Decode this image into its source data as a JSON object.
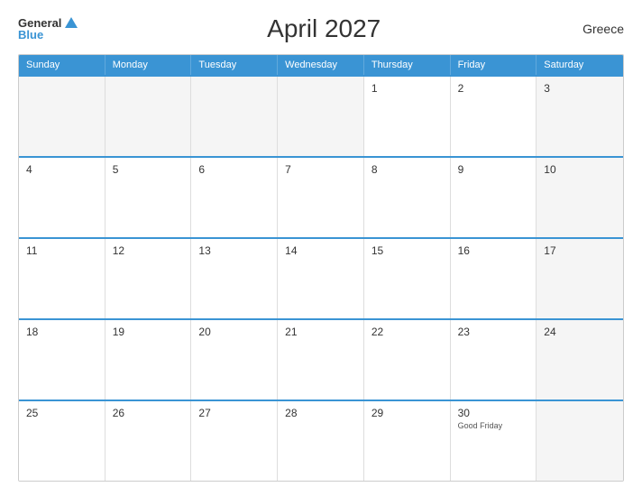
{
  "header": {
    "title": "April 2027",
    "country": "Greece",
    "logo": {
      "general": "General",
      "blue": "Blue"
    }
  },
  "dayNames": [
    "Sunday",
    "Monday",
    "Tuesday",
    "Wednesday",
    "Thursday",
    "Friday",
    "Saturday"
  ],
  "weeks": [
    [
      {
        "day": "",
        "empty": true
      },
      {
        "day": "",
        "empty": true
      },
      {
        "day": "",
        "empty": true
      },
      {
        "day": "",
        "empty": true
      },
      {
        "day": "1",
        "empty": false
      },
      {
        "day": "2",
        "empty": false
      },
      {
        "day": "3",
        "empty": false,
        "shaded": true
      }
    ],
    [
      {
        "day": "4",
        "shaded": false
      },
      {
        "day": "5",
        "shaded": false
      },
      {
        "day": "6",
        "shaded": false
      },
      {
        "day": "7",
        "shaded": false
      },
      {
        "day": "8",
        "shaded": false
      },
      {
        "day": "9",
        "shaded": false
      },
      {
        "day": "10",
        "shaded": true
      }
    ],
    [
      {
        "day": "11",
        "shaded": false
      },
      {
        "day": "12",
        "shaded": false
      },
      {
        "day": "13",
        "shaded": false
      },
      {
        "day": "14",
        "shaded": false
      },
      {
        "day": "15",
        "shaded": false
      },
      {
        "day": "16",
        "shaded": false
      },
      {
        "day": "17",
        "shaded": true
      }
    ],
    [
      {
        "day": "18",
        "shaded": false
      },
      {
        "day": "19",
        "shaded": false
      },
      {
        "day": "20",
        "shaded": false
      },
      {
        "day": "21",
        "shaded": false
      },
      {
        "day": "22",
        "shaded": false
      },
      {
        "day": "23",
        "shaded": false
      },
      {
        "day": "24",
        "shaded": true
      }
    ],
    [
      {
        "day": "25",
        "shaded": false
      },
      {
        "day": "26",
        "shaded": false
      },
      {
        "day": "27",
        "shaded": false
      },
      {
        "day": "28",
        "shaded": false
      },
      {
        "day": "29",
        "shaded": false
      },
      {
        "day": "30",
        "shaded": false,
        "holiday": "Good Friday"
      },
      {
        "day": "",
        "empty": true,
        "shaded": true
      }
    ]
  ]
}
